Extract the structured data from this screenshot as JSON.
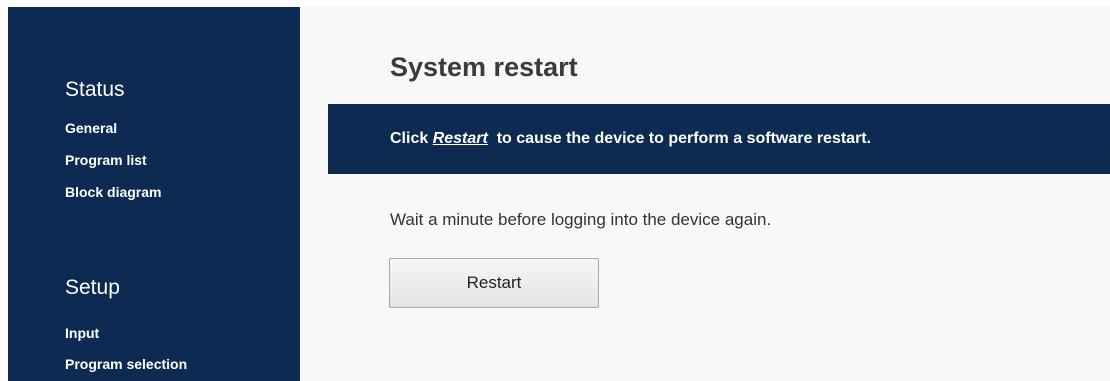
{
  "sidebar": {
    "sections": [
      {
        "heading": "Status",
        "items": [
          "General",
          "Program list",
          "Block diagram"
        ]
      },
      {
        "heading": "Setup",
        "items": [
          "Input",
          "Program selection"
        ]
      }
    ]
  },
  "main": {
    "title": "System restart",
    "banner": {
      "prefix": "Click ",
      "link": "Restart",
      "suffix": "  to cause the device to perform a software restart."
    },
    "info": "Wait a minute before logging into the device again.",
    "restart_button": "Restart"
  },
  "colors": {
    "sidebar_bg": "#0c2a52",
    "banner_bg": "#0c2a52",
    "main_bg": "#f8f8f8"
  }
}
